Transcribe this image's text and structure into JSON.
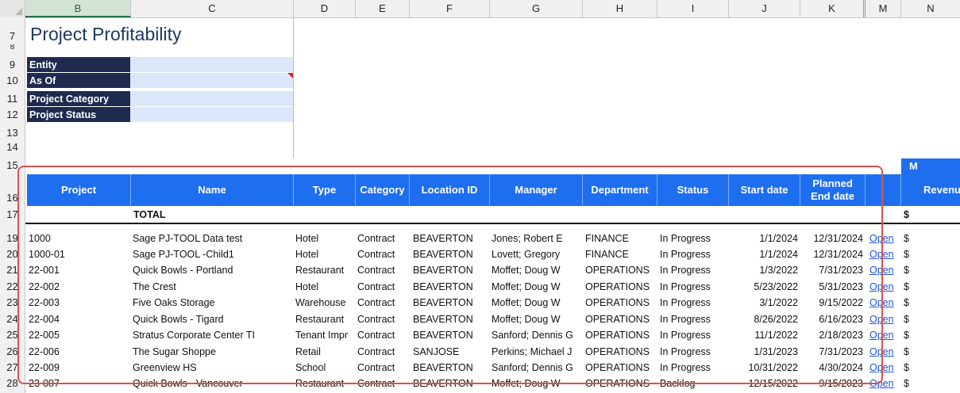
{
  "columns": [
    "B",
    "C",
    "D",
    "E",
    "F",
    "G",
    "H",
    "I",
    "J",
    "K",
    "M",
    "N"
  ],
  "title": "Project Profitability",
  "filters": [
    {
      "row": "9",
      "label": "Entity",
      "value": ""
    },
    {
      "row": "10",
      "label": "As Of",
      "value": ""
    },
    {
      "row": "11",
      "label": "Project Category",
      "value": ""
    },
    {
      "row": "12",
      "label": "Project Status",
      "value": ""
    }
  ],
  "extra_rows": [
    "7",
    "8",
    "13",
    "14",
    "15",
    "16",
    "17",
    "19",
    "20",
    "21",
    "22",
    "23",
    "24",
    "25",
    "26",
    "27",
    "28"
  ],
  "top_header_fragment": "M",
  "headers": {
    "project": "Project",
    "name": "Name",
    "type": "Type",
    "category": "Category",
    "location": "Location ID",
    "manager": "Manager",
    "department": "Department",
    "status": "Status",
    "start": "Start date",
    "planned_end_1": "Planned",
    "planned_end_2": "End date",
    "revenue": "Revenu"
  },
  "total": {
    "label": "TOTAL",
    "currency": "$"
  },
  "rows": [
    {
      "row": "19",
      "project": "1000",
      "name": "Sage PJ-TOOL Data test",
      "type": "Hotel",
      "category": "Contract",
      "location": "BEAVERTON",
      "manager": "Jones; Robert E",
      "department": "FINANCE",
      "status": "In Progress",
      "start": "1/1/2024",
      "end": "12/31/2024",
      "link": "Open",
      "cur": "$"
    },
    {
      "row": "20",
      "project": "1000-01",
      "name": "Sage PJ-TOOL -Child1",
      "type": "Hotel",
      "category": "Contract",
      "location": "BEAVERTON",
      "manager": "Lovett; Gregory",
      "department": "FINANCE",
      "status": "In Progress",
      "start": "1/1/2024",
      "end": "12/31/2024",
      "link": "Open",
      "cur": "$"
    },
    {
      "row": "21",
      "project": "22-001",
      "name": "Quick Bowls - Portland",
      "type": "Restaurant",
      "category": "Contract",
      "location": "BEAVERTON",
      "manager": "Moffet; Doug W",
      "department": "OPERATIONS",
      "status": "In Progress",
      "start": "1/3/2022",
      "end": "7/31/2023",
      "link": "Open",
      "cur": "$"
    },
    {
      "row": "22",
      "project": "22-002",
      "name": "The Crest",
      "type": "Hotel",
      "category": "Contract",
      "location": "BEAVERTON",
      "manager": "Moffet; Doug W",
      "department": "OPERATIONS",
      "status": "In Progress",
      "start": "5/23/2022",
      "end": "5/31/2023",
      "link": "Open",
      "cur": "$"
    },
    {
      "row": "23",
      "project": "22-003",
      "name": "Five Oaks Storage",
      "type": "Warehouse",
      "category": "Contract",
      "location": "BEAVERTON",
      "manager": "Moffet; Doug W",
      "department": "OPERATIONS",
      "status": "In Progress",
      "start": "3/1/2022",
      "end": "9/15/2022",
      "link": "Open",
      "cur": "$"
    },
    {
      "row": "24",
      "project": "22-004",
      "name": "Quick Bowls - Tigard",
      "type": "Restaurant",
      "category": "Contract",
      "location": "BEAVERTON",
      "manager": "Moffet; Doug W",
      "department": "OPERATIONS",
      "status": "In Progress",
      "start": "8/26/2022",
      "end": "6/16/2023",
      "link": "Open",
      "cur": "$"
    },
    {
      "row": "25",
      "project": "22-005",
      "name": "Stratus Corporate Center TI",
      "type": "Tenant Impr",
      "category": "Contract",
      "location": "BEAVERTON",
      "manager": "Sanford; Dennis G",
      "department": "OPERATIONS",
      "status": "In Progress",
      "start": "11/1/2022",
      "end": "2/18/2023",
      "link": "Open",
      "cur": "$"
    },
    {
      "row": "26",
      "project": "22-006",
      "name": "The Sugar Shoppe",
      "type": "Retail",
      "category": "Contract",
      "location": "SANJOSE",
      "manager": "Perkins; Michael J",
      "department": "OPERATIONS",
      "status": "In Progress",
      "start": "1/31/2023",
      "end": "7/31/2023",
      "link": "Open",
      "cur": "$"
    },
    {
      "row": "27",
      "project": "22-009",
      "name": "Greenview HS",
      "type": "School",
      "category": "Contract",
      "location": "BEAVERTON",
      "manager": "Sanford; Dennis G",
      "department": "OPERATIONS",
      "status": "In Progress",
      "start": "10/31/2022",
      "end": "4/30/2024",
      "link": "Open",
      "cur": "$"
    },
    {
      "row": "28",
      "project": "23-007",
      "name": "Quick Bowls - Vancouver",
      "type": "Restaurant",
      "category": "Contract",
      "location": "BEAVERTON",
      "manager": "Moffet; Doug W",
      "department": "OPERATIONS",
      "status": "Backlog",
      "start": "12/15/2022",
      "end": "9/15/2023",
      "link": "Open",
      "cur": "$"
    }
  ]
}
